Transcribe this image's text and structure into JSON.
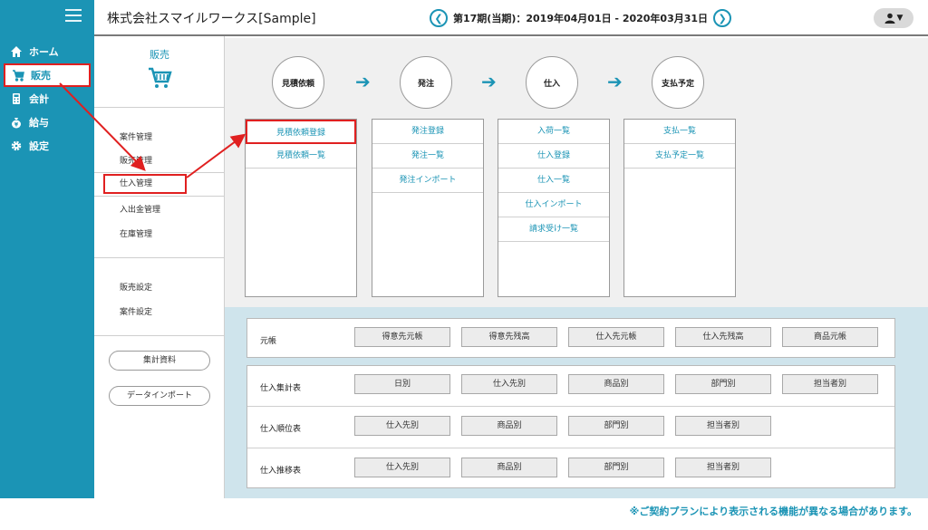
{
  "header": {
    "company": "株式会社スマイルワークス[Sample]",
    "period": "第17期(当期)：2019年04月01日 - 2020年03月31日",
    "prev": "❮",
    "next": "❯",
    "user_caret": "▼"
  },
  "sidebar": {
    "items": [
      {
        "label": "ホーム",
        "icon": "home-icon"
      },
      {
        "label": "販売",
        "icon": "cart-icon"
      },
      {
        "label": "会計",
        "icon": "calculator-icon"
      },
      {
        "label": "給与",
        "icon": "money-bag-icon"
      },
      {
        "label": "設定",
        "icon": "gear-icon"
      }
    ]
  },
  "submenu": {
    "title": "販売",
    "group1": [
      "案件管理",
      "販売管理",
      "仕入管理",
      "入出金管理",
      "在庫管理"
    ],
    "group2": [
      "販売設定",
      "案件設定"
    ],
    "buttons": [
      "集計資料",
      "データインポート"
    ]
  },
  "flow": {
    "nodes": [
      "見積依頼",
      "発注",
      "仕入",
      "支払予定"
    ],
    "arrow": "➔",
    "columns": [
      [
        "見積依頼登録",
        "見積依頼一覧"
      ],
      [
        "発注登録",
        "発注一覧",
        "発注インポート"
      ],
      [
        "入荷一覧",
        "仕入登録",
        "仕入一覧",
        "仕入インポート",
        "請求受け一覧"
      ],
      [
        "支払一覧",
        "支払予定一覧"
      ]
    ]
  },
  "reports": {
    "rows": [
      {
        "label": "元帳",
        "buttons": [
          "得意先元帳",
          "得意先残高",
          "仕入先元帳",
          "仕入先残高",
          "商品元帳"
        ]
      },
      {
        "label": "仕入集計表",
        "buttons": [
          "日別",
          "仕入先別",
          "商品別",
          "部門別",
          "担当者別"
        ]
      },
      {
        "label": "仕入順位表",
        "buttons": [
          "仕入先別",
          "商品別",
          "部門別",
          "担当者別"
        ]
      },
      {
        "label": "仕入推移表",
        "buttons": [
          "仕入先別",
          "商品別",
          "部門別",
          "担当者別"
        ]
      }
    ]
  },
  "footnote": "※ご契約プランにより表示される機能が異なる場合があります。",
  "colors": {
    "accent": "#1b94b5",
    "highlight": "#e02020"
  }
}
